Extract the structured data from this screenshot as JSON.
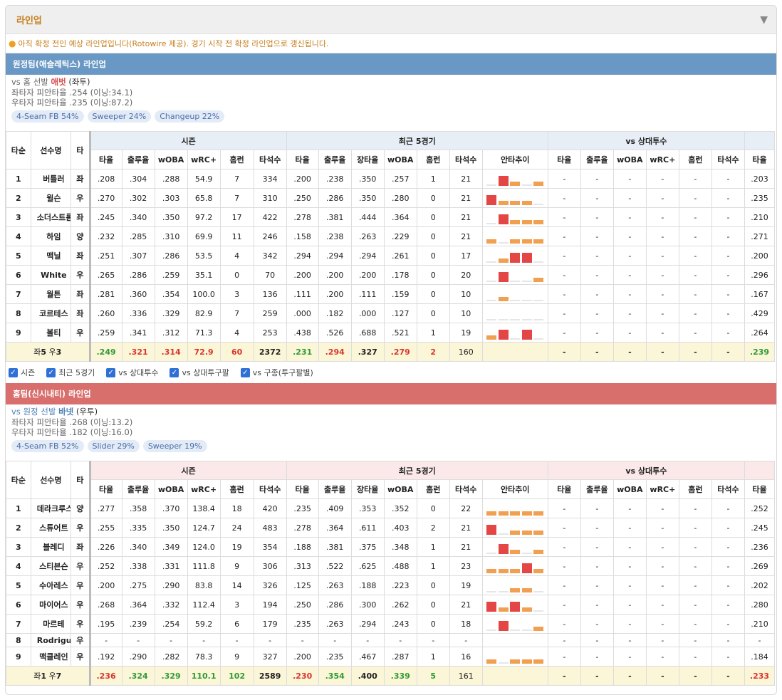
{
  "header": {
    "title": "라인업"
  },
  "notice": "아직 확정 전인 예상 라인업입니다(Rotowire 제공). 경기 시작 전 확정 라인업으로 갱신됩니다.",
  "columns": {
    "order": "타순",
    "name": "선수명",
    "hand": "타",
    "group_season": "시즌",
    "group_recent": "최근 5경기",
    "group_vs": "vs 상대투수",
    "season": [
      "타율",
      "출루율",
      "wOBA",
      "wRC+",
      "홈런",
      "타석수"
    ],
    "recent": [
      "타율",
      "출루율",
      "장타율",
      "wOBA",
      "홈런",
      "타석수",
      "안타추이"
    ],
    "vs": [
      "타율",
      "출루율",
      "wOBA",
      "wRC+",
      "홈런",
      "타석수"
    ],
    "extra": "타율"
  },
  "away": {
    "team_label": "원정팀(애슬레틱스) 라인업",
    "vs_prefix": "vs 홈 선발",
    "pitcher": "애벗",
    "pitcher_hand": "(좌투)",
    "split_left": "좌타자 피안타율 .254 (이닝:34.1)",
    "split_right": "우타자 피안타율 .235 (이닝:87.2)",
    "pitches": [
      "4-Seam FB 54%",
      "Sweeper 24%",
      "Changeup 22%"
    ],
    "players": [
      {
        "order": "1",
        "name": "버틀러",
        "hand": "좌",
        "s": [
          ".208",
          ".304",
          ".288",
          "54.9",
          "7",
          "334"
        ],
        "r": [
          ".200",
          ".238",
          ".350",
          ".257",
          "1",
          "21"
        ],
        "trend": [
          0,
          2,
          1,
          0,
          1
        ],
        "x": ".203"
      },
      {
        "order": "2",
        "name": "윌슨",
        "hand": "우",
        "s": [
          ".270",
          ".302",
          ".303",
          "65.8",
          "7",
          "310"
        ],
        "r": [
          ".250",
          ".286",
          ".350",
          ".280",
          "0",
          "21"
        ],
        "trend": [
          2,
          1,
          1,
          1,
          0
        ],
        "x": ".235"
      },
      {
        "order": "3",
        "name": "소더스트롬",
        "hand": "좌",
        "s": [
          ".245",
          ".340",
          ".350",
          "97.2",
          "17",
          "422"
        ],
        "r": [
          ".278",
          ".381",
          ".444",
          ".364",
          "0",
          "21"
        ],
        "trend": [
          0,
          2,
          1,
          1,
          1
        ],
        "x": ".210"
      },
      {
        "order": "4",
        "name": "하임",
        "hand": "양",
        "s": [
          ".232",
          ".285",
          ".310",
          "69.9",
          "11",
          "246"
        ],
        "r": [
          ".158",
          ".238",
          ".263",
          ".229",
          "0",
          "21"
        ],
        "trend": [
          1,
          0,
          1,
          1,
          1
        ],
        "x": ".271"
      },
      {
        "order": "5",
        "name": "맥닐",
        "hand": "좌",
        "s": [
          ".251",
          ".307",
          ".286",
          "53.5",
          "4",
          "342"
        ],
        "r": [
          ".294",
          ".294",
          ".294",
          ".261",
          "0",
          "17"
        ],
        "trend": [
          0,
          1,
          2,
          2,
          0
        ],
        "x": ".200"
      },
      {
        "order": "6",
        "name": "White",
        "hand": "우",
        "s": [
          ".265",
          ".286",
          ".259",
          "35.1",
          "0",
          "70"
        ],
        "r": [
          ".200",
          ".200",
          ".200",
          ".178",
          "0",
          "20"
        ],
        "trend": [
          0,
          2,
          0,
          0,
          1
        ],
        "x": ".296"
      },
      {
        "order": "7",
        "name": "월튼",
        "hand": "좌",
        "s": [
          ".281",
          ".360",
          ".354",
          "100.0",
          "3",
          "136"
        ],
        "r": [
          ".111",
          ".200",
          ".111",
          ".159",
          "0",
          "10"
        ],
        "trend": [
          0,
          1,
          0,
          0,
          0
        ],
        "x": ".167"
      },
      {
        "order": "8",
        "name": "코르테스",
        "hand": "좌",
        "s": [
          ".260",
          ".336",
          ".329",
          "82.9",
          "7",
          "259"
        ],
        "r": [
          ".000",
          ".182",
          ".000",
          ".127",
          "0",
          "10"
        ],
        "trend": [
          0,
          0,
          0,
          0,
          0
        ],
        "x": ".429"
      },
      {
        "order": "9",
        "name": "볼티",
        "hand": "우",
        "s": [
          ".259",
          ".341",
          ".312",
          "71.3",
          "4",
          "253"
        ],
        "r": [
          ".438",
          ".526",
          ".688",
          ".521",
          "1",
          "19"
        ],
        "trend": [
          1,
          2,
          0,
          2,
          0
        ],
        "x": ".264"
      }
    ],
    "total": {
      "label_prefix": "좌",
      "left": "5",
      "label_mid": " 우",
      "right": "3",
      "s": [
        ".249",
        ".321",
        ".314",
        "72.9",
        "60",
        "2372"
      ],
      "r": [
        ".231",
        ".294",
        ".327",
        ".279",
        "2",
        "160"
      ],
      "x": ".239"
    }
  },
  "filters": [
    "시즌",
    "최근 5경기",
    "vs 상대투수",
    "vs 상대투구팔",
    "vs 구종(투구팔별)"
  ],
  "home": {
    "team_label": "홈팀(신시내티) 라인업",
    "vs_prefix": "vs 원정 선발",
    "pitcher": "바넷",
    "pitcher_hand": "(우투)",
    "split_left": "좌타자 피안타율 .268 (이닝:13.2)",
    "split_right": "우타자 피안타율 .182 (이닝:16.0)",
    "pitches": [
      "4-Seam FB 52%",
      "Slider 29%",
      "Sweeper 19%"
    ],
    "players": [
      {
        "order": "1",
        "name": "데라크루스",
        "hand": "양",
        "s": [
          ".277",
          ".358",
          ".370",
          "138.4",
          "18",
          "420"
        ],
        "r": [
          ".235",
          ".409",
          ".353",
          ".352",
          "0",
          "22"
        ],
        "trend": [
          1,
          1,
          1,
          1,
          1
        ],
        "x": ".252"
      },
      {
        "order": "2",
        "name": "스튜어트",
        "hand": "우",
        "s": [
          ".255",
          ".335",
          ".350",
          "124.7",
          "24",
          "483"
        ],
        "r": [
          ".278",
          ".364",
          ".611",
          ".403",
          "2",
          "21"
        ],
        "trend": [
          2,
          0,
          1,
          1,
          1
        ],
        "x": ".245"
      },
      {
        "order": "3",
        "name": "블레디",
        "hand": "좌",
        "s": [
          ".226",
          ".340",
          ".349",
          "124.0",
          "19",
          "354"
        ],
        "r": [
          ".188",
          ".381",
          ".375",
          ".348",
          "1",
          "21"
        ],
        "trend": [
          0,
          2,
          1,
          0,
          1
        ],
        "x": ".236"
      },
      {
        "order": "4",
        "name": "스티븐슨",
        "hand": "우",
        "s": [
          ".252",
          ".338",
          ".331",
          "111.8",
          "9",
          "306"
        ],
        "r": [
          ".313",
          ".522",
          ".625",
          ".488",
          "1",
          "23"
        ],
        "trend": [
          1,
          1,
          1,
          2,
          1
        ],
        "x": ".269"
      },
      {
        "order": "5",
        "name": "수아레스",
        "hand": "우",
        "s": [
          ".200",
          ".275",
          ".290",
          "83.8",
          "14",
          "326"
        ],
        "r": [
          ".125",
          ".263",
          ".188",
          ".223",
          "0",
          "19"
        ],
        "trend": [
          0,
          0,
          1,
          1,
          0
        ],
        "x": ".202"
      },
      {
        "order": "6",
        "name": "마이어스",
        "hand": "우",
        "s": [
          ".268",
          ".364",
          ".332",
          "112.4",
          "3",
          "194"
        ],
        "r": [
          ".250",
          ".286",
          ".300",
          ".262",
          "0",
          "21"
        ],
        "trend": [
          2,
          1,
          2,
          1,
          0
        ],
        "x": ".280"
      },
      {
        "order": "7",
        "name": "마르테",
        "hand": "우",
        "s": [
          ".195",
          ".239",
          ".254",
          "59.2",
          "6",
          "179"
        ],
        "r": [
          ".235",
          ".263",
          ".294",
          ".243",
          "0",
          "18"
        ],
        "trend": [
          0,
          2,
          0,
          0,
          1
        ],
        "x": ".210"
      },
      {
        "order": "8",
        "name": "Rodriguez",
        "hand": "우",
        "s": [
          "-",
          "-",
          "-",
          "-",
          "-",
          "-"
        ],
        "r": [
          "-",
          "-",
          "-",
          "-",
          "-",
          "-"
        ],
        "trend": [],
        "x": "-",
        "short": true
      },
      {
        "order": "9",
        "name": "맥클레인",
        "hand": "우",
        "s": [
          ".192",
          ".290",
          ".282",
          "78.3",
          "9",
          "327"
        ],
        "r": [
          ".200",
          ".235",
          ".467",
          ".287",
          "1",
          "16"
        ],
        "trend": [
          1,
          0,
          1,
          1,
          1
        ],
        "x": ".184"
      }
    ],
    "total": {
      "label_prefix": "좌",
      "left": "1",
      "label_mid": " 우",
      "right": "7",
      "s": [
        ".236",
        ".324",
        ".329",
        "110.1",
        "102",
        "2589"
      ],
      "r": [
        ".230",
        ".354",
        ".400",
        ".339",
        "5",
        "161"
      ],
      "x": ".233"
    }
  },
  "colors": {
    "away_bar": "#6a98c5",
    "home_bar": "#d86f6d",
    "hit_high": "#e44545",
    "hit_mid": "#f0a050",
    "total_row": "#fcf6d9"
  }
}
